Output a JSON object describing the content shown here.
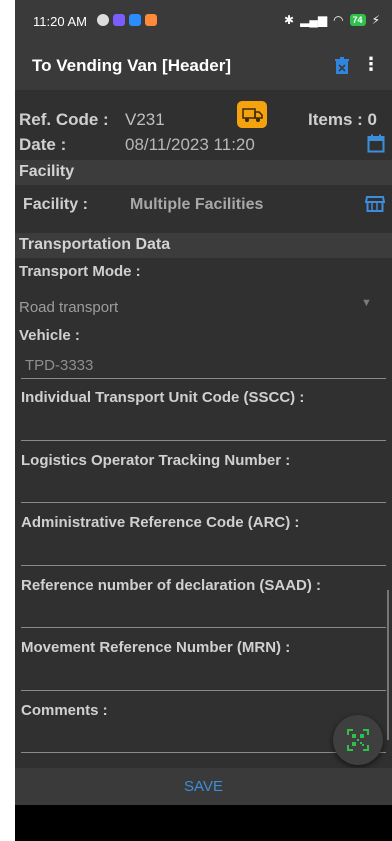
{
  "status_bar": {
    "time": "11:20 AM",
    "battery": "74"
  },
  "app_bar": {
    "title": "To Vending Van [Header]"
  },
  "header": {
    "ref_code_label": "Ref. Code :",
    "ref_code_value": "V231",
    "items_label": "Items : 0",
    "date_label": "Date :",
    "date_value": "08/11/2023 11:20"
  },
  "facility_section": {
    "title": "Facility",
    "label": "Facility :",
    "value": "Multiple Facilities"
  },
  "transport_section": {
    "title": "Transportation Data",
    "mode_label": "Transport Mode :",
    "mode_value": "Road transport",
    "vehicle_label": "Vehicle :",
    "vehicle_value": "TPD-3333",
    "fields": [
      {
        "label": "Individual Transport Unit Code (SSCC) :"
      },
      {
        "label": "Logistics Operator Tracking Number :"
      },
      {
        "label": "Administrative Reference Code (ARC) :"
      },
      {
        "label": "Reference number of declaration (SAAD) :"
      },
      {
        "label": "Movement Reference Number (MRN) :"
      },
      {
        "label": "Comments :"
      }
    ]
  },
  "save_label": "SAVE",
  "colors": {
    "accent": "#3c8edc",
    "badge": "#f5a20f",
    "qr": "#2fbf4a",
    "background": "#303030"
  }
}
